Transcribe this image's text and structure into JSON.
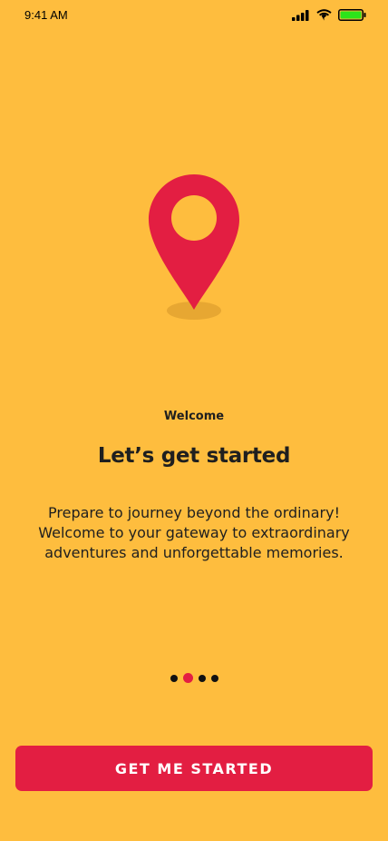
{
  "status_bar": {
    "time": "9:41 AM",
    "icons": [
      "cellular-signal-icon",
      "wifi-icon",
      "battery-icon"
    ],
    "battery_color": "#2BE41A"
  },
  "illustration": {
    "icon": "location-pin-icon",
    "pin_color": "#E31E42",
    "shadow_color": "#E7A732"
  },
  "onboarding": {
    "eyebrow": "Welcome",
    "title": "Let’s get started",
    "description": "Prepare to journey beyond the ordinary! Welcome to your gateway to extraordinary adventures and unforgettable memories."
  },
  "pager": {
    "total_pages": 4,
    "active_index": 1
  },
  "cta": {
    "label": "GET ME STARTED"
  },
  "colors": {
    "background": "#FEBD3E",
    "accent": "#E31E42",
    "text": "#1F1F1F"
  }
}
